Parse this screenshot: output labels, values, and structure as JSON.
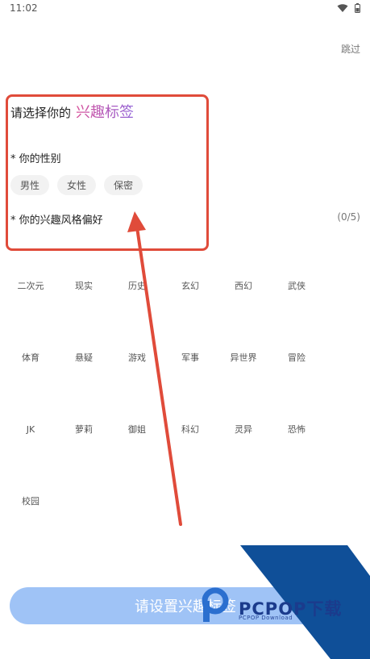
{
  "status": {
    "time": "11:02",
    "wifi_icon": "wifi-icon",
    "battery_icon": "battery-icon"
  },
  "header": {
    "skip_label": "跳过"
  },
  "title": {
    "prefix": "请选择你的",
    "accent": "兴趣标签"
  },
  "gender": {
    "label": "* 你的性别",
    "options": [
      "男性",
      "女性",
      "保密"
    ]
  },
  "preference": {
    "label": "* 你的兴趣风格偏好",
    "count": "(0/5)",
    "tags": [
      "二次元",
      "现实",
      "历史",
      "玄幻",
      "西幻",
      "武侠",
      "体育",
      "悬疑",
      "游戏",
      "军事",
      "异世界",
      "冒险",
      "JK",
      "萝莉",
      "御姐",
      "科幻",
      "灵异",
      "恐怖",
      "校园"
    ]
  },
  "submit": {
    "label": "请设置兴趣标签"
  },
  "watermark": {
    "brand": "PCPOP下载",
    "sub": "PCPOP Download"
  },
  "colors": {
    "accent_start": "#d9539b",
    "accent_end": "#8f5fd6",
    "button_bg": "#9fc3f6",
    "annotation_red": "#e04b3a"
  }
}
